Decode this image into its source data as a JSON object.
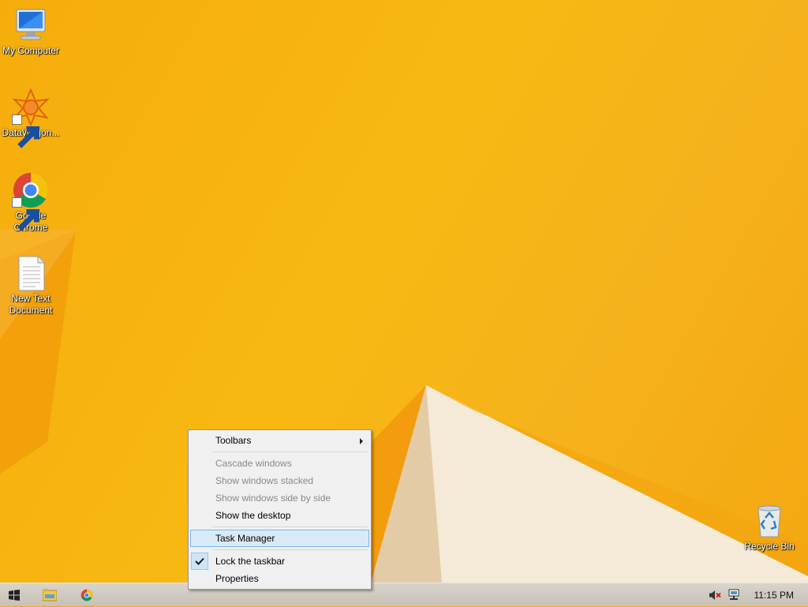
{
  "desktop": {
    "icons": [
      {
        "label": "My Computer"
      },
      {
        "label": "DataWagon..."
      },
      {
        "label": "Google Chrome"
      },
      {
        "label": "New Text Document"
      },
      {
        "label": "Recycle Bin"
      }
    ]
  },
  "context_menu": {
    "items": [
      {
        "label": "Toolbars",
        "enabled": true,
        "submenu": true
      },
      {
        "label": "Cascade windows",
        "enabled": false
      },
      {
        "label": "Show windows stacked",
        "enabled": false
      },
      {
        "label": "Show windows side by side",
        "enabled": false
      },
      {
        "label": "Show the desktop",
        "enabled": true
      },
      {
        "label": "Task Manager",
        "enabled": true,
        "highlighted": true
      },
      {
        "label": "Lock the taskbar",
        "enabled": true,
        "checked": true
      },
      {
        "label": "Properties",
        "enabled": true
      }
    ]
  },
  "taskbar": {
    "start_icon": "windows-logo-icon",
    "pinned": [
      "file-explorer-icon",
      "chrome-icon"
    ],
    "tray_icons": [
      "volume-muted-icon",
      "network-icon"
    ],
    "clock": "11:15 PM"
  },
  "colors": {
    "wallpaper": "#f6ad0c",
    "menu_highlight": "#d9eaf7",
    "menu_highlight_border": "#7eb4ea"
  }
}
